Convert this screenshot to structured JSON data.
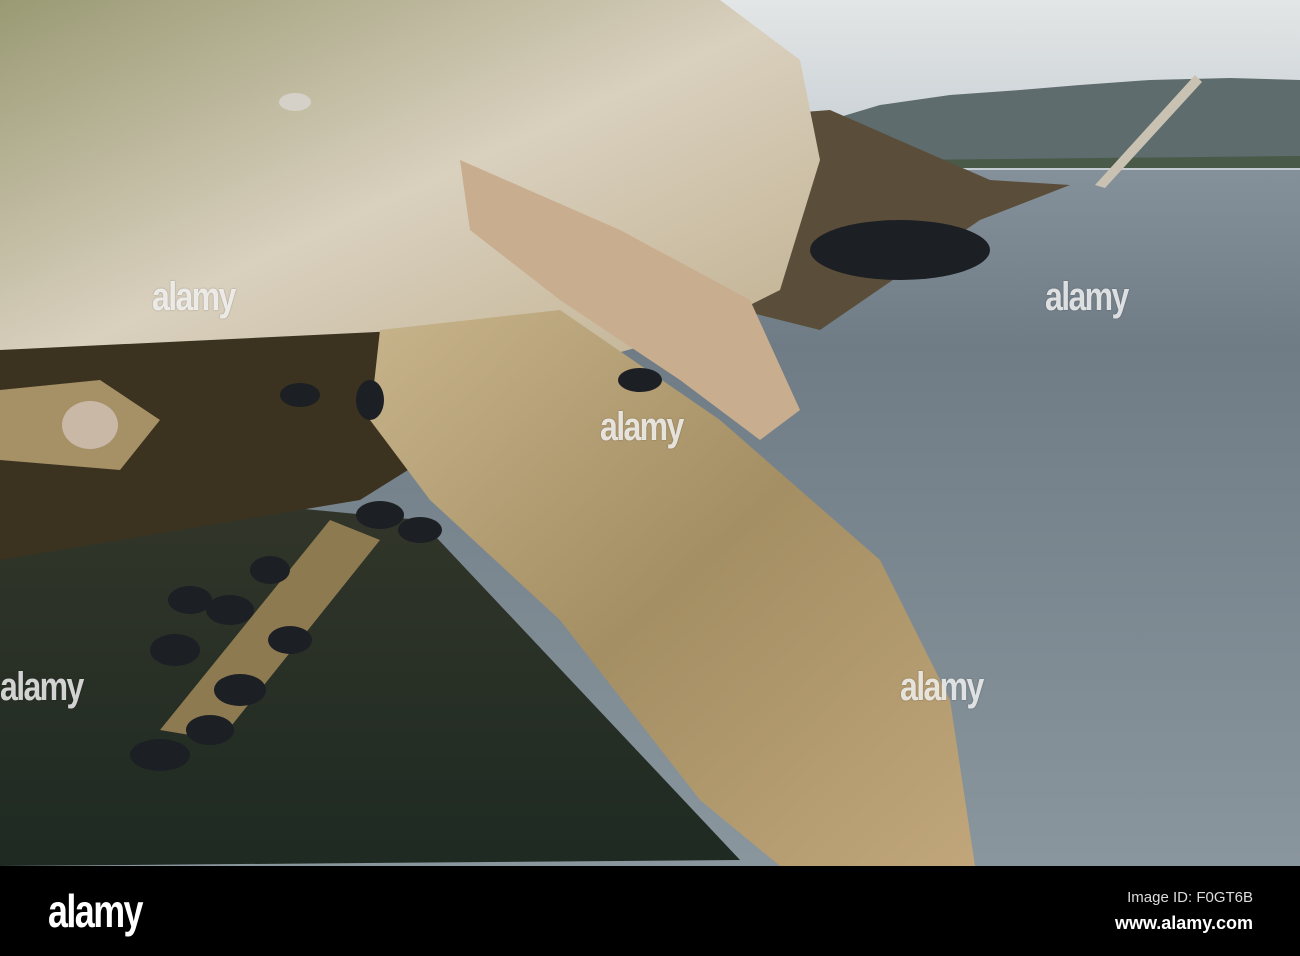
{
  "watermark": {
    "text": "alamy"
  },
  "footer": {
    "logo": "alamy",
    "image_id": "Image ID: F0GT6B",
    "url": "www.alamy.com"
  },
  "colors": {
    "sky": "#cfd6dc",
    "water": "#7f8b92",
    "wood": "#a8946b",
    "mussel": "#1c1f24"
  }
}
